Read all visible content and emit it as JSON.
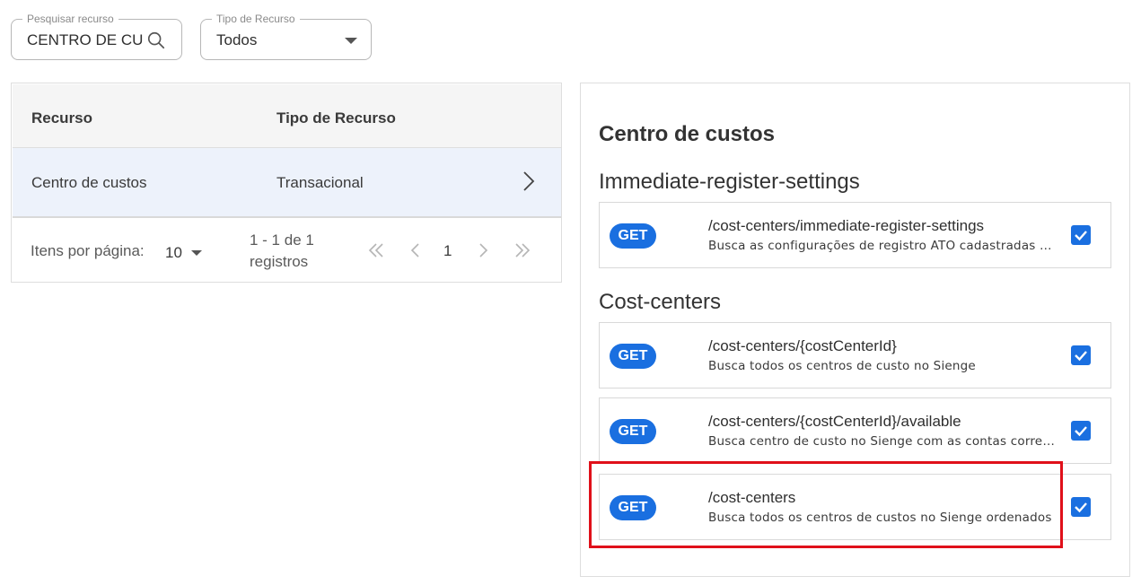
{
  "filters": {
    "search": {
      "label": "Pesquisar recurso",
      "value": "CENTRO DE CU"
    },
    "type": {
      "label": "Tipo de Recurso",
      "value": "Todos"
    }
  },
  "table": {
    "headers": [
      "Recurso",
      "Tipo de Recurso"
    ],
    "rows": [
      {
        "resource": "Centro de custos",
        "type": "Transacional"
      }
    ],
    "pagination": {
      "items_label": "Itens por página:",
      "page_size": "10",
      "range_line1": "1 - 1 de 1",
      "range_line2": "registros",
      "current_page": "1"
    }
  },
  "detail": {
    "title": "Centro de custos",
    "groups": [
      {
        "name": "Immediate-register-settings",
        "endpoints": [
          {
            "method": "GET",
            "path": "/cost-centers/immediate-register-settings",
            "description": "Busca as configurações de registro ATO cadastradas no Sienge",
            "checked": true
          }
        ]
      },
      {
        "name": "Cost-centers",
        "endpoints": [
          {
            "method": "GET",
            "path": "/cost-centers/{costCenterId}",
            "description": "Busca todos os centros de custo no Sienge",
            "checked": true
          },
          {
            "method": "GET",
            "path": "/cost-centers/{costCenterId}/available",
            "description": "Busca centro de custo no Sienge com as contas correntes",
            "checked": true
          },
          {
            "method": "GET",
            "path": "/cost-centers",
            "description": "Busca todos os centros de custos no Sienge ordenados",
            "checked": true
          }
        ]
      }
    ]
  },
  "colors": {
    "accent": "#1a6fe0",
    "highlight": "#e0101a",
    "selected_row": "#edf2fb"
  }
}
